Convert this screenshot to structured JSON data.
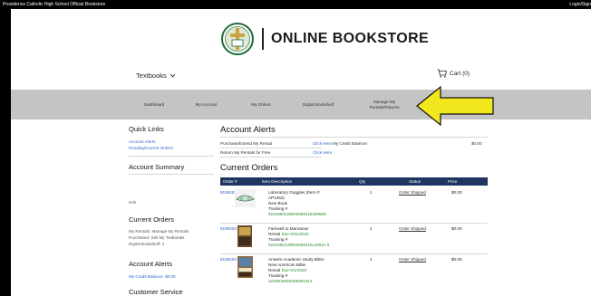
{
  "topbar": {
    "school": "Providence Catholic High School Official Bookstore",
    "login": "Login/Sign"
  },
  "header": {
    "title": "ONLINE BOOKSTORE",
    "category_dropdown": "Textbooks",
    "cart_label": "Cart (0)"
  },
  "nav": {
    "items": [
      {
        "label": "Dashboard"
      },
      {
        "label": "My Account"
      },
      {
        "label": "My Orders"
      },
      {
        "label": "Digital Bookshelf"
      },
      {
        "label_line1": "Manage My",
        "label_line2": "Rentals/Returns"
      }
    ]
  },
  "sidebar": {
    "quick_links_title": "Quick Links",
    "quick_links": [
      "Account Alerts",
      "Pending/Current Orders"
    ],
    "account_summary_title": "Account Summary",
    "edit_label": "Edit",
    "current_orders_title": "Current Orders",
    "current_orders_lines": [
      "My Rentals: Manage My Rentals",
      "Purchased: Sell My Textbooks",
      "Digital Bookshelf: 1"
    ],
    "account_alerts_title": "Account Alerts",
    "credit_line": "My Credit Balance: $0.00",
    "customer_service_title": "Customer Service"
  },
  "account_alerts": {
    "title": "Account Alerts",
    "rows": [
      {
        "label": "Purchase/Extend My Rental",
        "link": "Click Here"
      },
      {
        "label": "Return My Rentals for Free",
        "link": "Click Here"
      }
    ],
    "credit_label": "My Credit Balance:",
    "credit_value": "$0.00"
  },
  "current_orders": {
    "title": "Current Orders",
    "headers": [
      "Order #",
      "Item Description",
      "Qty",
      "Status",
      "Price"
    ],
    "rows": [
      {
        "order": "8199203",
        "line1": "Laboratory Goggles (Item #:",
        "line2": "AP1362)",
        "line3": "New Book",
        "tracking_label": "Tracking #",
        "tracking": "9241990129602658116209588",
        "qty": "1",
        "status": "Order Shipped",
        "price": "$0.00"
      },
      {
        "order": "8199203",
        "line1": "Farewell to Manzanar",
        "line2": "Rental",
        "due": "Due 5/31/2020",
        "tracking_label": "Tracking #",
        "tracking": "9241990129602658116140521 8",
        "qty": "1",
        "status": "Order Shipped",
        "price": "$0.00"
      },
      {
        "order": "8199203",
        "line1": "Anselm Academic Study Bible:",
        "line2": "New American Bible",
        "line3": "Rental",
        "due": "Due 6/1/2020",
        "tracking_label": "Tracking #",
        "tracking": "1Z29E3W55355951014",
        "qty": "1",
        "status": "Order Shipped",
        "price": "$0.00"
      }
    ]
  },
  "colors": {
    "accent_blue": "#1e3461",
    "link_blue": "#2b67c2",
    "nav_gray": "#c4c4c4",
    "arrow_yellow": "#f2e61c",
    "due_green": "#2e8b2e"
  },
  "icons": [
    "cross-emblem-icon",
    "chevron-down-icon",
    "cart-icon",
    "goggles-thumbnail",
    "book-thumbnail",
    "bible-thumbnail",
    "yellow-arrow-icon"
  ]
}
